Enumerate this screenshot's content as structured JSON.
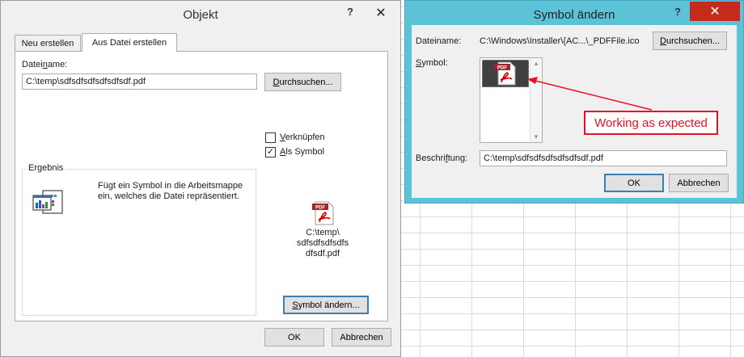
{
  "objekt_dialog": {
    "title": "Objekt",
    "help": "?",
    "close": "✕",
    "tabs": [
      "Neu erstellen",
      "Aus Datei erstellen"
    ],
    "filename_label_pre": "Datei",
    "filename_label_u": "n",
    "filename_label_post": "ame:",
    "filename_value": "C:\\temp\\sdfsdfsdfsdfsdfsdf.pdf",
    "browse_u": "D",
    "browse_rest": "urchsuchen...",
    "link_u": "V",
    "link_rest": "erknüpfen",
    "link_checked": false,
    "as_symbol_u": "A",
    "as_symbol_rest": "ls Symbol",
    "as_symbol_checked": true,
    "result_label": "Ergebnis",
    "result_text": "Fügt ein Symbol in die Arbeitsmappe ein, welches die Datei repräsentiert.",
    "icon_caption_lines": [
      "C:\\temp\\",
      "sdfsdfsdfsdfs",
      "dfsdf.pdf"
    ],
    "change_icon_u": "S",
    "change_icon_rest": "ymbol ändern...",
    "ok": "OK",
    "cancel": "Abbrechen"
  },
  "symbol_dialog": {
    "title": "Symbol ändern",
    "help": "?",
    "close": "✕",
    "filename_label": "Dateiname:",
    "filename_value": "C:\\Windows\\Installer\\{AC...\\_PDFFile.ico",
    "browse_u": "D",
    "browse_rest": "urchsuchen...",
    "symbol_label_u": "S",
    "symbol_label_rest": "ymbol:",
    "caption_label_pre": "Beschri",
    "caption_label_u": "f",
    "caption_label_post": "tung:",
    "caption_value": "C:\\temp\\sdfsdfsdfsdfsdfsdf.pdf",
    "ok": "OK",
    "cancel": "Abbrechen"
  },
  "annotation": {
    "text": "Working as expected",
    "color": "#e81123"
  },
  "colors": {
    "dialog_bg": "#f0f0f0",
    "symbol_frame": "#5bc2d8",
    "close_red": "#c42b1c"
  },
  "icons": {
    "pdf_file": "pdf-file-icon",
    "embed_result": "embed-as-icon-icon"
  }
}
